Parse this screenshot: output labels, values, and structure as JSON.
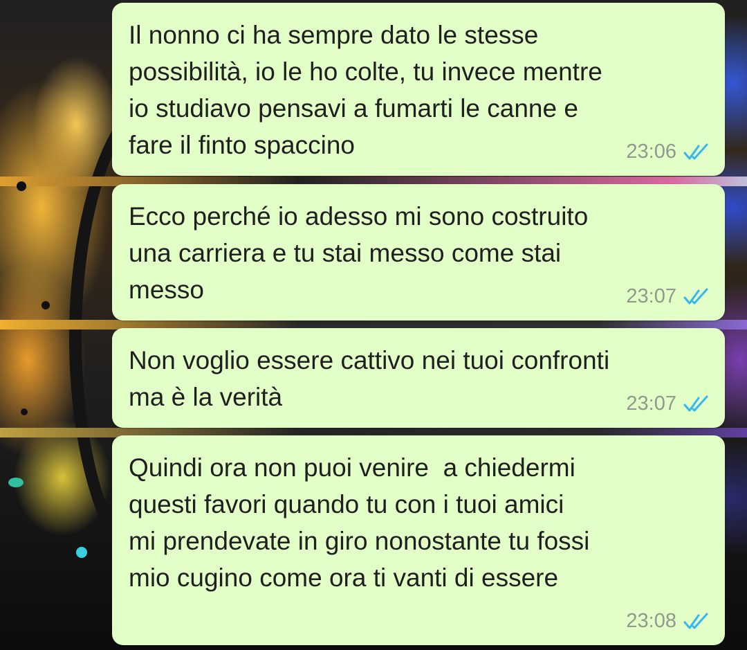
{
  "colors": {
    "bubble_bg": "#e1ffc7",
    "text": "#1f1f1f",
    "time": "#8f9a8a",
    "read_ticks": "#34b7f1"
  },
  "messages": [
    {
      "text": "Il nonno ci ha sempre dato le stesse\npossibilità, io le ho colte, tu invece mentre\nio studiavo pensavi a fumarti le canne e\nfare il finto spaccino",
      "time": "23:06",
      "status_icon": "double-check-read-icon"
    },
    {
      "text": "Ecco perché io adesso mi sono costruito\nuna carriera e tu stai messo come stai\nmesso",
      "time": "23:07",
      "status_icon": "double-check-read-icon"
    },
    {
      "text": "Non voglio essere cattivo nei tuoi confronti\nma è la verità",
      "time": "23:07",
      "status_icon": "double-check-read-icon"
    },
    {
      "text": "Quindi ora non puoi venire  a chiedermi\nquesti favori quando tu con i tuoi amici\nmi prendevate in giro nonostante tu fossi\nmio cugino come ora ti vanti di essere",
      "time": "23:08",
      "status_icon": "double-check-read-icon"
    }
  ]
}
